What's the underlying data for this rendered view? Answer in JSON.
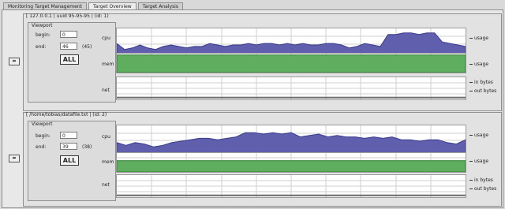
{
  "tabs": [
    {
      "label": "Monitoring Target Management"
    },
    {
      "label": "Target Overview"
    },
    {
      "label": "Target Analysis"
    }
  ],
  "targets": [
    {
      "title": "[ 127.0.0.1 | uuid 95-95-95 | (id: 1)",
      "remove_icon": "remove-target-icon",
      "viewport": {
        "title": "Viewport",
        "begin_label": "begin:",
        "begin_value": "0",
        "end_label": "end:",
        "end_value": "46",
        "end_count": "(45)",
        "all_label": "ALL"
      },
      "metrics": {
        "cpu_label": "cpu",
        "cpu_legend": "usage",
        "mem_label": "mem",
        "mem_legend": "usage",
        "net_label": "net",
        "net_in_legend": "in bytes",
        "net_out_legend": "out bytes"
      }
    },
    {
      "title": "[ /home/tobias/datafile.txt | (id: 2)",
      "remove_icon": "remove-target-icon",
      "viewport": {
        "title": "Viewport",
        "begin_label": "begin:",
        "begin_value": "0",
        "end_label": "end:",
        "end_value": "39",
        "end_count": "(38)",
        "all_label": "ALL"
      },
      "metrics": {
        "cpu_label": "cpu",
        "cpu_legend": "usage",
        "mem_label": "mem",
        "mem_legend": "usage",
        "net_label": "net",
        "net_in_legend": "in bytes",
        "net_out_legend": "out bytes"
      }
    }
  ],
  "colors": {
    "cpu_fill": "#5f5fae",
    "cpu_stroke": "#3b3b8c",
    "mem_fill": "#5fae5f",
    "mem_stroke": "#2f7f2f",
    "grid": "#cfcfcf"
  },
  "graph_data": [
    {
      "cpu": [
        0.55,
        0.35,
        0.4,
        0.5,
        0.4,
        0.35,
        0.45,
        0.5,
        0.45,
        0.4,
        0.45,
        0.45,
        0.55,
        0.5,
        0.45,
        0.5,
        0.5,
        0.55,
        0.5,
        0.55,
        0.55,
        0.5,
        0.55,
        0.5,
        0.55,
        0.5,
        0.5,
        0.55,
        0.55,
        0.5,
        0.4,
        0.45,
        0.55,
        0.5,
        0.45,
        0.85,
        0.85,
        0.9,
        0.9,
        0.85,
        0.9,
        0.9,
        0.6,
        0.55,
        0.5,
        0.45
      ],
      "mem": 0.97
    },
    {
      "cpu": [
        0.45,
        0.35,
        0.45,
        0.4,
        0.3,
        0.35,
        0.45,
        0.5,
        0.55,
        0.6,
        0.6,
        0.55,
        0.6,
        0.65,
        0.8,
        0.8,
        0.75,
        0.8,
        0.75,
        0.8,
        0.65,
        0.7,
        0.75,
        0.65,
        0.7,
        0.65,
        0.65,
        0.6,
        0.65,
        0.6,
        0.65,
        0.55,
        0.55,
        0.5,
        0.55,
        0.55,
        0.45,
        0.4,
        0.55
      ],
      "mem": 0.62
    }
  ]
}
